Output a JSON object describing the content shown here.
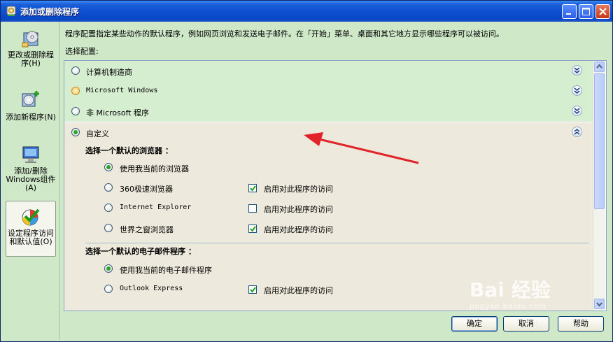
{
  "window": {
    "title": "添加或删除程序",
    "controls": [
      "minimize-icon",
      "maximize-icon",
      "close-icon"
    ]
  },
  "sidebar": {
    "items": [
      {
        "label": "更改或删除程序(H)",
        "icon": "cd-box-icon",
        "selected": false
      },
      {
        "label": "添加新程序(N)",
        "icon": "install-cd-icon",
        "selected": false
      },
      {
        "label": "添加/删除Windows组件(A)",
        "icon": "windows-components-icon",
        "selected": false
      },
      {
        "label": "设定程序访问和默认值(O)",
        "icon": "program-defaults-icon",
        "selected": true
      }
    ]
  },
  "main": {
    "description": "程序配置指定某些动作的默认程序，例如网页浏览和发送电子邮件。在「开始」菜单、桌面和其它地方显示哪些程序可以被访问。",
    "choose_label": "选择配置:",
    "configs": [
      {
        "label": "计算机制造商",
        "selected": false
      },
      {
        "label": "Microsoft Windows",
        "selected": false
      },
      {
        "label": "非 Microsoft 程序",
        "selected": false
      },
      {
        "label": "自定义",
        "selected": true
      }
    ],
    "browser_section": {
      "title": "选择一个默认的浏览器 ：",
      "options": [
        {
          "label": "使用我当前的浏览器",
          "selected": true,
          "access_label": "",
          "access_checked": null
        },
        {
          "label": "360极速浏览器",
          "selected": false,
          "access_label": "启用对此程序的访问",
          "access_checked": true
        },
        {
          "label": "Internet Explorer",
          "selected": false,
          "access_label": "启用对此程序的访问",
          "access_checked": false
        },
        {
          "label": "世界之窗浏览器",
          "selected": false,
          "access_label": "启用对此程序的访问",
          "access_checked": true
        }
      ]
    },
    "email_section": {
      "title": "选择一个默认的电子邮件程序 ：",
      "options": [
        {
          "label": "使用我当前的电子邮件程序",
          "selected": true,
          "access_label": "",
          "access_checked": null
        },
        {
          "label": "Outlook Express",
          "selected": false,
          "access_label": "启用对此程序的访问",
          "access_checked": true
        }
      ]
    },
    "buttons": {
      "ok": "确定",
      "cancel": "取消",
      "help": "帮助"
    }
  },
  "watermark": {
    "brand": "Bai 经验",
    "url": "jingyan.baidu.com"
  },
  "colors": {
    "titlebar": "#0d4fd0",
    "background": "#cfe8c8",
    "selected_band": "#ede9dc",
    "arrow": "#e0242a"
  }
}
